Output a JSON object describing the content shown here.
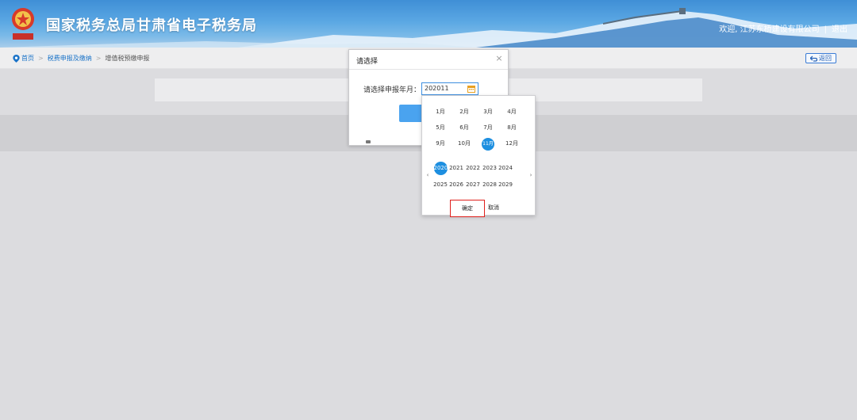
{
  "header": {
    "site_title": "国家税务总局甘肃省电子税务局",
    "welcome": "欢迎, 江苏东桥建设有限公司",
    "separator": "|",
    "logout": "退出"
  },
  "breadcrumb": {
    "home": "首页",
    "level1": "税费申报及缴纳",
    "level2": "增值税预缴申报",
    "arrow": ">",
    "back_label": "返回"
  },
  "dialog": {
    "title": "请选择",
    "close": "×",
    "period_label": "请选择申报年月：",
    "period_value": "202011"
  },
  "picker": {
    "months": [
      "1月",
      "2月",
      "3月",
      "4月",
      "5月",
      "6月",
      "7月",
      "8月",
      "9月",
      "10月",
      "11月",
      "12月"
    ],
    "selected_month": "11月",
    "years": [
      "2020",
      "2021",
      "2022",
      "2023",
      "2024",
      "2025",
      "2026",
      "2027",
      "2028",
      "2029"
    ],
    "selected_year": "2020",
    "prev": "‹",
    "next": "›",
    "ok_label": "确定",
    "cancel_label": "取消"
  },
  "colors": {
    "header_blue": "#3f8fd6",
    "accent_blue": "#1d8fe0",
    "highlight_red": "#e0201c"
  }
}
